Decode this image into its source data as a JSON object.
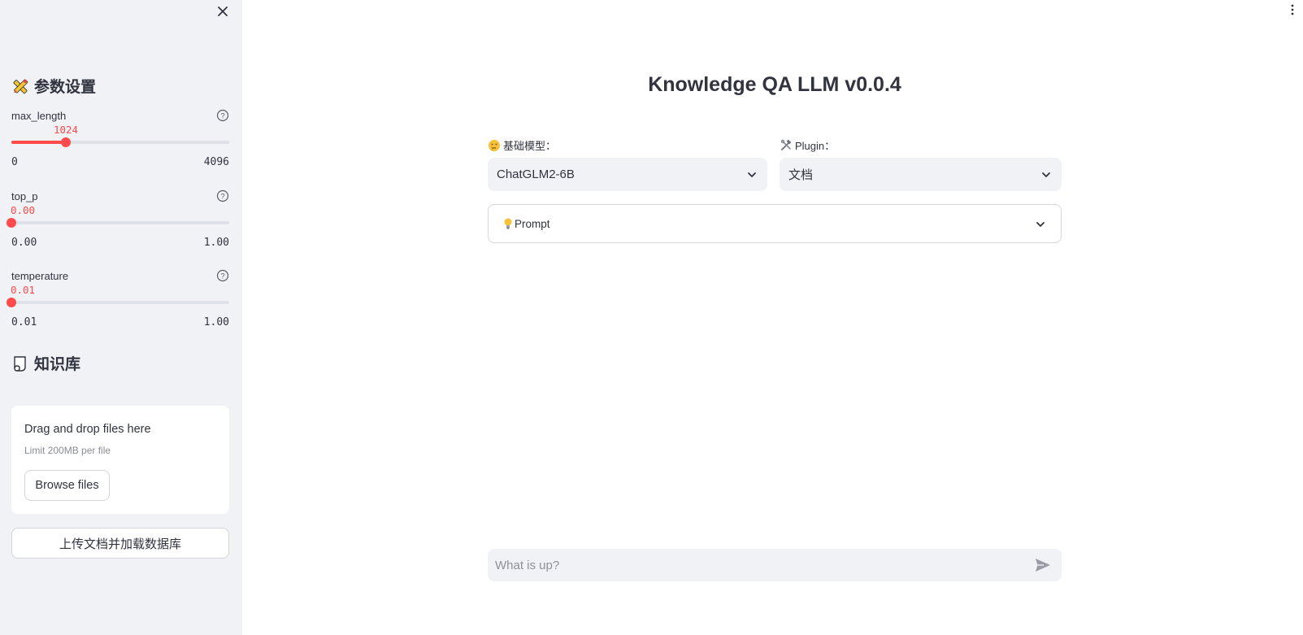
{
  "sidebar": {
    "params_heading": "参数设置",
    "sliders": [
      {
        "label": "max_length",
        "value_text": "1024",
        "value": 1024,
        "min_text": "0",
        "max_text": "4096",
        "min": 0,
        "max": 4096
      },
      {
        "label": "top_p",
        "value_text": "0.00",
        "value": 0.0,
        "min_text": "0.00",
        "max_text": "1.00",
        "min": 0.0,
        "max": 1.0
      },
      {
        "label": "temperature",
        "value_text": "0.01",
        "value": 0.01,
        "min_text": "0.01",
        "max_text": "1.00",
        "min": 0.01,
        "max": 1.0
      }
    ],
    "kb_heading": "知识库",
    "uploader": {
      "drop_text": "Drag and drop files here",
      "limit_text": "Limit 200MB per file",
      "browse_label": "Browse files"
    },
    "upload_load_label": "上传文档并加载数据库"
  },
  "main": {
    "title": "Knowledge QA LLM v0.0.4",
    "model_select": {
      "label": "基础模型：",
      "value": "ChatGLM2-6B"
    },
    "plugin_select": {
      "label": "Plugin：",
      "value": "文档"
    },
    "prompt_expander": {
      "label": "Prompt"
    },
    "chat": {
      "placeholder": "What is up?"
    }
  },
  "colors": {
    "accent": "#ff4b4b",
    "sidebar_bg": "#f0f2f6",
    "text": "#31333f"
  },
  "icons": {
    "close": "close-icon",
    "menu": "more-vertical-icon",
    "params": "pencil-ruler-icon",
    "kb": "page-curl-icon",
    "help": "question-circle-icon",
    "model": "thinking-face-icon",
    "plugin": "hammer-wrench-icon",
    "prompt": "lightbulb-icon",
    "send": "send-icon",
    "chevron": "chevron-down-icon"
  }
}
